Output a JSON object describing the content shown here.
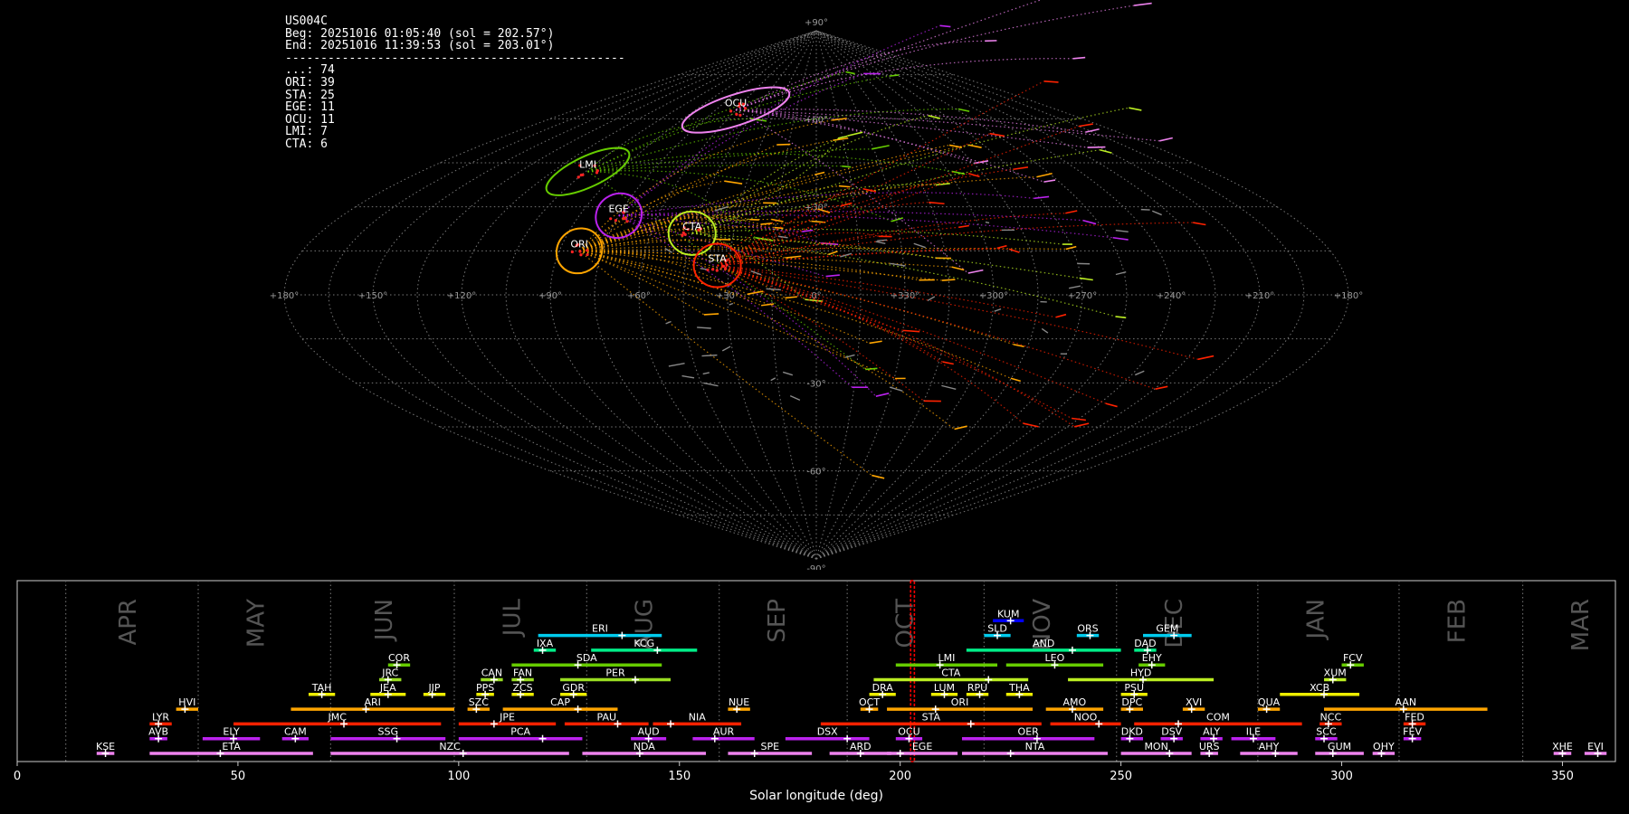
{
  "info": {
    "station": "US004C",
    "begin": "Beg: 20251016 01:05:40 (sol = 202.57°)",
    "end": "End: 20251016 11:39:53 (sol = 203.01°)",
    "separator": "------------------------------------------------",
    "counts": [
      "...: 74",
      "ORI: 39",
      "STA: 25",
      "EGE: 11",
      "OCU: 11",
      "LMI: 7",
      "CTA: 6"
    ]
  },
  "chart_data": [
    {
      "type": "scatter",
      "projection": "sinusoidal",
      "lon_labels": [
        "+180°",
        "+150°",
        "+120°",
        "+90°",
        "+60°",
        "+30°",
        "0°",
        "+330°",
        "+300°",
        "+270°",
        "+240°",
        "+210°",
        "+180°"
      ],
      "lat_labels": [
        "+90°",
        "+60°",
        "+30°",
        "-30°",
        "-60°",
        "-90°"
      ],
      "lon_range": [
        0,
        360
      ],
      "lat_range": [
        -90,
        90
      ],
      "grid": true,
      "radiants": [
        {
          "code": "OCU",
          "lon": -60,
          "lat": 63,
          "color": "#ee82ee"
        },
        {
          "code": "LMI",
          "lon": -104,
          "lat": 42,
          "color": "#66cc00"
        },
        {
          "code": "EGE",
          "lon": -75,
          "lat": 27,
          "color": "#bb22ee"
        },
        {
          "code": "ORI",
          "lon": -83,
          "lat": 15,
          "color": "#ffa500"
        },
        {
          "code": "CTA",
          "lon": -45,
          "lat": 21,
          "color": "#bbee22"
        },
        {
          "code": "STA",
          "lon": -34,
          "lat": 10,
          "color": "#ff2200"
        }
      ],
      "colors": {
        "ORI": "#ffa500",
        "STA": "#ff2200",
        "EGE": "#bb22ee",
        "OCU": "#ee82ee",
        "LMI": "#66cc00",
        "CTA": "#bbee22",
        "sporadic": "#888888"
      }
    },
    {
      "type": "timeline",
      "xlabel": "Solar longitude (deg)",
      "xlim": [
        0,
        362
      ],
      "xticks": [
        0,
        50,
        100,
        150,
        200,
        250,
        300,
        350
      ],
      "current_sol": [
        202.57,
        203.01
      ],
      "months": [
        {
          "name": "APR",
          "sol": 25
        },
        {
          "name": "MAY",
          "sol": 54
        },
        {
          "name": "JUN",
          "sol": 83
        },
        {
          "name": "JUL",
          "sol": 112
        },
        {
          "name": "AUG",
          "sol": 142
        },
        {
          "name": "SEP",
          "sol": 172
        },
        {
          "name": "OCT",
          "sol": 201
        },
        {
          "name": "NOV",
          "sol": 232
        },
        {
          "name": "DEC",
          "sol": 262
        },
        {
          "name": "JAN",
          "sol": 294
        },
        {
          "name": "FEB",
          "sol": 326
        },
        {
          "name": "MAR",
          "sol": 354
        }
      ],
      "month_boundaries": [
        11,
        41,
        71,
        99,
        129,
        159,
        188,
        219,
        249,
        281,
        313,
        341
      ],
      "showers": [
        {
          "code": "KUM",
          "start": 221,
          "end": 228,
          "peak": 225,
          "row": 12,
          "color": "#0000ff"
        },
        {
          "code": "ERI",
          "start": 118,
          "end": 146,
          "peak": 137,
          "row": 11,
          "color": "#00ccee"
        },
        {
          "code": "SLD",
          "start": 219,
          "end": 225,
          "peak": 222,
          "row": 11,
          "color": "#00ccee"
        },
        {
          "code": "ORS",
          "start": 240,
          "end": 245,
          "peak": 243,
          "row": 11,
          "color": "#00ccee"
        },
        {
          "code": "GEM",
          "start": 255,
          "end": 266,
          "peak": 262,
          "row": 11,
          "color": "#00ccee"
        },
        {
          "code": "IXA",
          "start": 117,
          "end": 122,
          "peak": 119,
          "row": 10,
          "color": "#00ee88"
        },
        {
          "code": "KCG",
          "start": 130,
          "end": 154,
          "peak": 145,
          "row": 10,
          "color": "#00ee88"
        },
        {
          "code": "AND",
          "start": 215,
          "end": 250,
          "peak": 239,
          "row": 10,
          "color": "#00ee88"
        },
        {
          "code": "DAD",
          "start": 253,
          "end": 258,
          "peak": 256,
          "row": 10,
          "color": "#00ee88"
        },
        {
          "code": "COR",
          "start": 84,
          "end": 89,
          "peak": 86,
          "row": 9,
          "color": "#66cc00"
        },
        {
          "code": "SDA",
          "start": 112,
          "end": 146,
          "peak": 127,
          "row": 9,
          "color": "#66cc00"
        },
        {
          "code": "LMI",
          "start": 199,
          "end": 222,
          "peak": 209,
          "row": 9,
          "color": "#66cc00"
        },
        {
          "code": "LEO",
          "start": 224,
          "end": 246,
          "peak": 235,
          "row": 9,
          "color": "#66cc00"
        },
        {
          "code": "EHY",
          "start": 254,
          "end": 260,
          "peak": 257,
          "row": 9,
          "color": "#66cc00"
        },
        {
          "code": "FCV",
          "start": 300,
          "end": 305,
          "peak": 302,
          "row": 9,
          "color": "#66cc00"
        },
        {
          "code": "JRC",
          "start": 82,
          "end": 87,
          "peak": 84,
          "row": 8,
          "color": "#99dd22"
        },
        {
          "code": "CAN",
          "start": 105,
          "end": 110,
          "peak": 108,
          "row": 8,
          "color": "#99dd22"
        },
        {
          "code": "FAN",
          "start": 112,
          "end": 117,
          "peak": 114,
          "row": 8,
          "color": "#99dd22"
        },
        {
          "code": "PER",
          "start": 123,
          "end": 148,
          "peak": 140,
          "row": 8,
          "color": "#99dd22"
        },
        {
          "code": "CTA",
          "start": 194,
          "end": 229,
          "peak": 220,
          "row": 8,
          "color": "#bbee22"
        },
        {
          "code": "HYD",
          "start": 238,
          "end": 271,
          "peak": 255,
          "row": 8,
          "color": "#bbee22"
        },
        {
          "code": "XUM",
          "start": 296,
          "end": 301,
          "peak": 298,
          "row": 8,
          "color": "#bbee22"
        },
        {
          "code": "TAH",
          "start": 66,
          "end": 72,
          "peak": 69,
          "row": 7,
          "color": "#eeee00"
        },
        {
          "code": "JEA",
          "start": 80,
          "end": 88,
          "peak": 84,
          "row": 7,
          "color": "#eeee00"
        },
        {
          "code": "JIP",
          "start": 92,
          "end": 97,
          "peak": 94,
          "row": 7,
          "color": "#eeee00"
        },
        {
          "code": "PPS",
          "start": 104,
          "end": 108,
          "peak": 106,
          "row": 7,
          "color": "#eeee00"
        },
        {
          "code": "ZCS",
          "start": 112,
          "end": 117,
          "peak": 114,
          "row": 7,
          "color": "#eeee00"
        },
        {
          "code": "GDR",
          "start": 123,
          "end": 129,
          "peak": 126,
          "row": 7,
          "color": "#eeee00"
        },
        {
          "code": "DRA",
          "start": 193,
          "end": 199,
          "peak": 196,
          "row": 7,
          "color": "#eeee00"
        },
        {
          "code": "LUM",
          "start": 207,
          "end": 213,
          "peak": 210,
          "row": 7,
          "color": "#eeee00"
        },
        {
          "code": "RPU",
          "start": 215,
          "end": 220,
          "peak": 218,
          "row": 7,
          "color": "#eeee00"
        },
        {
          "code": "THA",
          "start": 224,
          "end": 230,
          "peak": 227,
          "row": 7,
          "color": "#eeee00"
        },
        {
          "code": "PSU",
          "start": 250,
          "end": 256,
          "peak": 253,
          "row": 7,
          "color": "#eeee00"
        },
        {
          "code": "XCB",
          "start": 286,
          "end": 304,
          "peak": 296,
          "row": 7,
          "color": "#eeee00"
        },
        {
          "code": "HVI",
          "start": 36,
          "end": 41,
          "peak": 38,
          "row": 6,
          "color": "#ffa500"
        },
        {
          "code": "ARI",
          "start": 62,
          "end": 99,
          "peak": 79,
          "row": 6,
          "color": "#ffa500"
        },
        {
          "code": "SZC",
          "start": 102,
          "end": 107,
          "peak": 104,
          "row": 6,
          "color": "#ffa500"
        },
        {
          "code": "CAP",
          "start": 110,
          "end": 136,
          "peak": 127,
          "row": 6,
          "color": "#ffa500"
        },
        {
          "code": "NUE",
          "start": 161,
          "end": 166,
          "peak": 163,
          "row": 6,
          "color": "#ffa500"
        },
        {
          "code": "OCT",
          "start": 191,
          "end": 195,
          "peak": 193,
          "row": 6,
          "color": "#ffa500"
        },
        {
          "code": "ORI",
          "start": 197,
          "end": 230,
          "peak": 208,
          "row": 6,
          "color": "#ffa500"
        },
        {
          "code": "AMO",
          "start": 233,
          "end": 246,
          "peak": 239,
          "row": 6,
          "color": "#ffa500"
        },
        {
          "code": "DPC",
          "start": 250,
          "end": 255,
          "peak": 252,
          "row": 6,
          "color": "#ffa500"
        },
        {
          "code": "XVI",
          "start": 264,
          "end": 269,
          "peak": 266,
          "row": 6,
          "color": "#ffa500"
        },
        {
          "code": "QUA",
          "start": 281,
          "end": 286,
          "peak": 283,
          "row": 6,
          "color": "#ffa500"
        },
        {
          "code": "AAN",
          "start": 296,
          "end": 333,
          "peak": 314,
          "row": 6,
          "color": "#ffa500"
        },
        {
          "code": "LYR",
          "start": 30,
          "end": 35,
          "peak": 32,
          "row": 5,
          "color": "#ff2200"
        },
        {
          "code": "JMC",
          "start": 49,
          "end": 96,
          "peak": 74,
          "row": 5,
          "color": "#ff2200"
        },
        {
          "code": "JPE",
          "start": 100,
          "end": 122,
          "peak": 108,
          "row": 5,
          "color": "#ff2200"
        },
        {
          "code": "PAU",
          "start": 124,
          "end": 143,
          "peak": 136,
          "row": 5,
          "color": "#ff2200"
        },
        {
          "code": "NIA",
          "start": 144,
          "end": 164,
          "peak": 148,
          "row": 5,
          "color": "#ff2200"
        },
        {
          "code": "STA",
          "start": 182,
          "end": 232,
          "peak": 216,
          "row": 5,
          "color": "#ff2200"
        },
        {
          "code": "NOO",
          "start": 234,
          "end": 250,
          "peak": 245,
          "row": 5,
          "color": "#ff2200"
        },
        {
          "code": "COM",
          "start": 253,
          "end": 291,
          "peak": 263,
          "row": 5,
          "color": "#ff2200"
        },
        {
          "code": "NCC",
          "start": 295,
          "end": 300,
          "peak": 297,
          "row": 5,
          "color": "#ff2200"
        },
        {
          "code": "FED",
          "start": 314,
          "end": 319,
          "peak": 316,
          "row": 5,
          "color": "#ff2200"
        },
        {
          "code": "AVB",
          "start": 30,
          "end": 34,
          "peak": 32,
          "row": 4,
          "color": "#bb22ee"
        },
        {
          "code": "ELY",
          "start": 42,
          "end": 55,
          "peak": 49,
          "row": 4,
          "color": "#bb22ee"
        },
        {
          "code": "CAM",
          "start": 60,
          "end": 66,
          "peak": 63,
          "row": 4,
          "color": "#bb22ee"
        },
        {
          "code": "SSG",
          "start": 71,
          "end": 97,
          "peak": 86,
          "row": 4,
          "color": "#bb22ee"
        },
        {
          "code": "PCA",
          "start": 100,
          "end": 128,
          "peak": 119,
          "row": 4,
          "color": "#bb22ee"
        },
        {
          "code": "AUD",
          "start": 139,
          "end": 147,
          "peak": 143,
          "row": 4,
          "color": "#bb22ee"
        },
        {
          "code": "AUR",
          "start": 153,
          "end": 167,
          "peak": 158,
          "row": 4,
          "color": "#bb22ee"
        },
        {
          "code": "DSX",
          "start": 174,
          "end": 193,
          "peak": 188,
          "row": 4,
          "color": "#bb22ee"
        },
        {
          "code": "OCU",
          "start": 199,
          "end": 205,
          "peak": 202,
          "row": 4,
          "color": "#bb22ee"
        },
        {
          "code": "OER",
          "start": 214,
          "end": 244,
          "peak": 231,
          "row": 4,
          "color": "#bb22ee"
        },
        {
          "code": "DKD",
          "start": 250,
          "end": 255,
          "peak": 252,
          "row": 4,
          "color": "#bb22ee"
        },
        {
          "code": "DSV",
          "start": 259,
          "end": 264,
          "peak": 262,
          "row": 4,
          "color": "#bb22ee"
        },
        {
          "code": "ALY",
          "start": 268,
          "end": 273,
          "peak": 271,
          "row": 4,
          "color": "#bb22ee"
        },
        {
          "code": "ILE",
          "start": 275,
          "end": 285,
          "peak": 280,
          "row": 4,
          "color": "#bb22ee"
        },
        {
          "code": "SCC",
          "start": 294,
          "end": 299,
          "peak": 296,
          "row": 4,
          "color": "#bb22ee"
        },
        {
          "code": "FEV",
          "start": 314,
          "end": 318,
          "peak": 316,
          "row": 4,
          "color": "#bb22ee"
        },
        {
          "code": "KSE",
          "start": 18,
          "end": 22,
          "peak": 20,
          "row": 3,
          "color": "#ee82ee"
        },
        {
          "code": "ETA",
          "start": 30,
          "end": 67,
          "peak": 46,
          "row": 3,
          "color": "#ee82ee"
        },
        {
          "code": "NZC",
          "start": 71,
          "end": 125,
          "peak": 101,
          "row": 3,
          "color": "#ee82ee"
        },
        {
          "code": "NDA",
          "start": 128,
          "end": 156,
          "peak": 141,
          "row": 3,
          "color": "#ee82ee"
        },
        {
          "code": "SPE",
          "start": 161,
          "end": 180,
          "peak": 167,
          "row": 3,
          "color": "#ee82ee"
        },
        {
          "code": "ARD",
          "start": 184,
          "end": 198,
          "peak": 191,
          "row": 3,
          "color": "#ee82ee"
        },
        {
          "code": "EGE",
          "start": 197,
          "end": 213,
          "peak": 200,
          "row": 3,
          "color": "#ee82ee"
        },
        {
          "code": "NTA",
          "start": 214,
          "end": 247,
          "peak": 225,
          "row": 3,
          "color": "#ee82ee"
        },
        {
          "code": "MON",
          "start": 250,
          "end": 266,
          "peak": 261,
          "row": 3,
          "color": "#ee82ee"
        },
        {
          "code": "URS",
          "start": 268,
          "end": 272,
          "peak": 270,
          "row": 3,
          "color": "#ee82ee"
        },
        {
          "code": "AHY",
          "start": 277,
          "end": 290,
          "peak": 285,
          "row": 3,
          "color": "#ee82ee"
        },
        {
          "code": "GUM",
          "start": 294,
          "end": 305,
          "peak": 298,
          "row": 3,
          "color": "#ee82ee"
        },
        {
          "code": "OHY",
          "start": 307,
          "end": 312,
          "peak": 309,
          "row": 3,
          "color": "#ee82ee"
        },
        {
          "code": "XHE",
          "start": 348,
          "end": 352,
          "peak": 350,
          "row": 3,
          "color": "#ee82ee"
        },
        {
          "code": "EVI",
          "start": 355,
          "end": 360,
          "peak": 358,
          "row": 3,
          "color": "#ee82ee"
        }
      ]
    }
  ]
}
